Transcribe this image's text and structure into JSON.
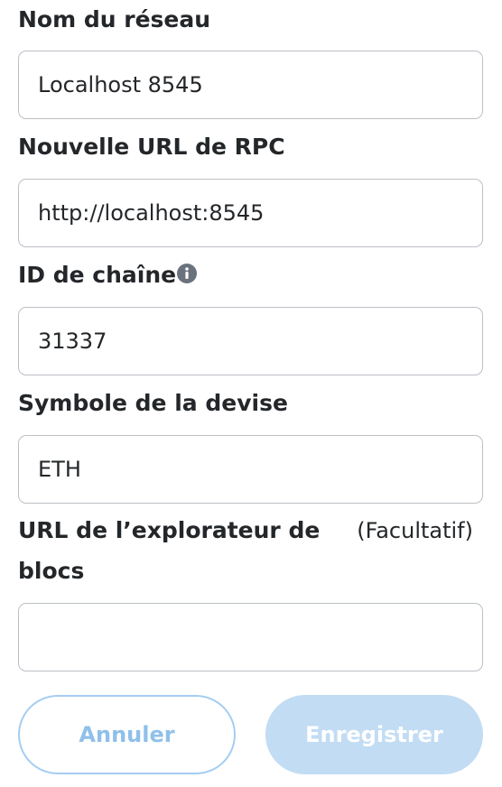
{
  "network_name": {
    "label": "Nom du réseau",
    "value": "Localhost 8545"
  },
  "rpc_url": {
    "label": "Nouvelle URL de RPC",
    "value": "http://localhost:8545"
  },
  "chain_id": {
    "label": "ID de chaîne",
    "value": "31337",
    "icon": "info-icon"
  },
  "currency_symbol": {
    "label": "Symbole de la devise",
    "value": "ETH"
  },
  "block_explorer": {
    "label_line1": "URL de l’explorateur de",
    "label_line2": "blocs",
    "optional": "(Facultatif)",
    "value": ""
  },
  "buttons": {
    "cancel": "Annuler",
    "save": "Enregistrer"
  },
  "colors": {
    "text": "#24272a",
    "border": "#bbc0c5",
    "primary_disabled": "#c2dcf3",
    "cancel_text": "#8fc0ea",
    "info_icon": "#6a737d"
  }
}
